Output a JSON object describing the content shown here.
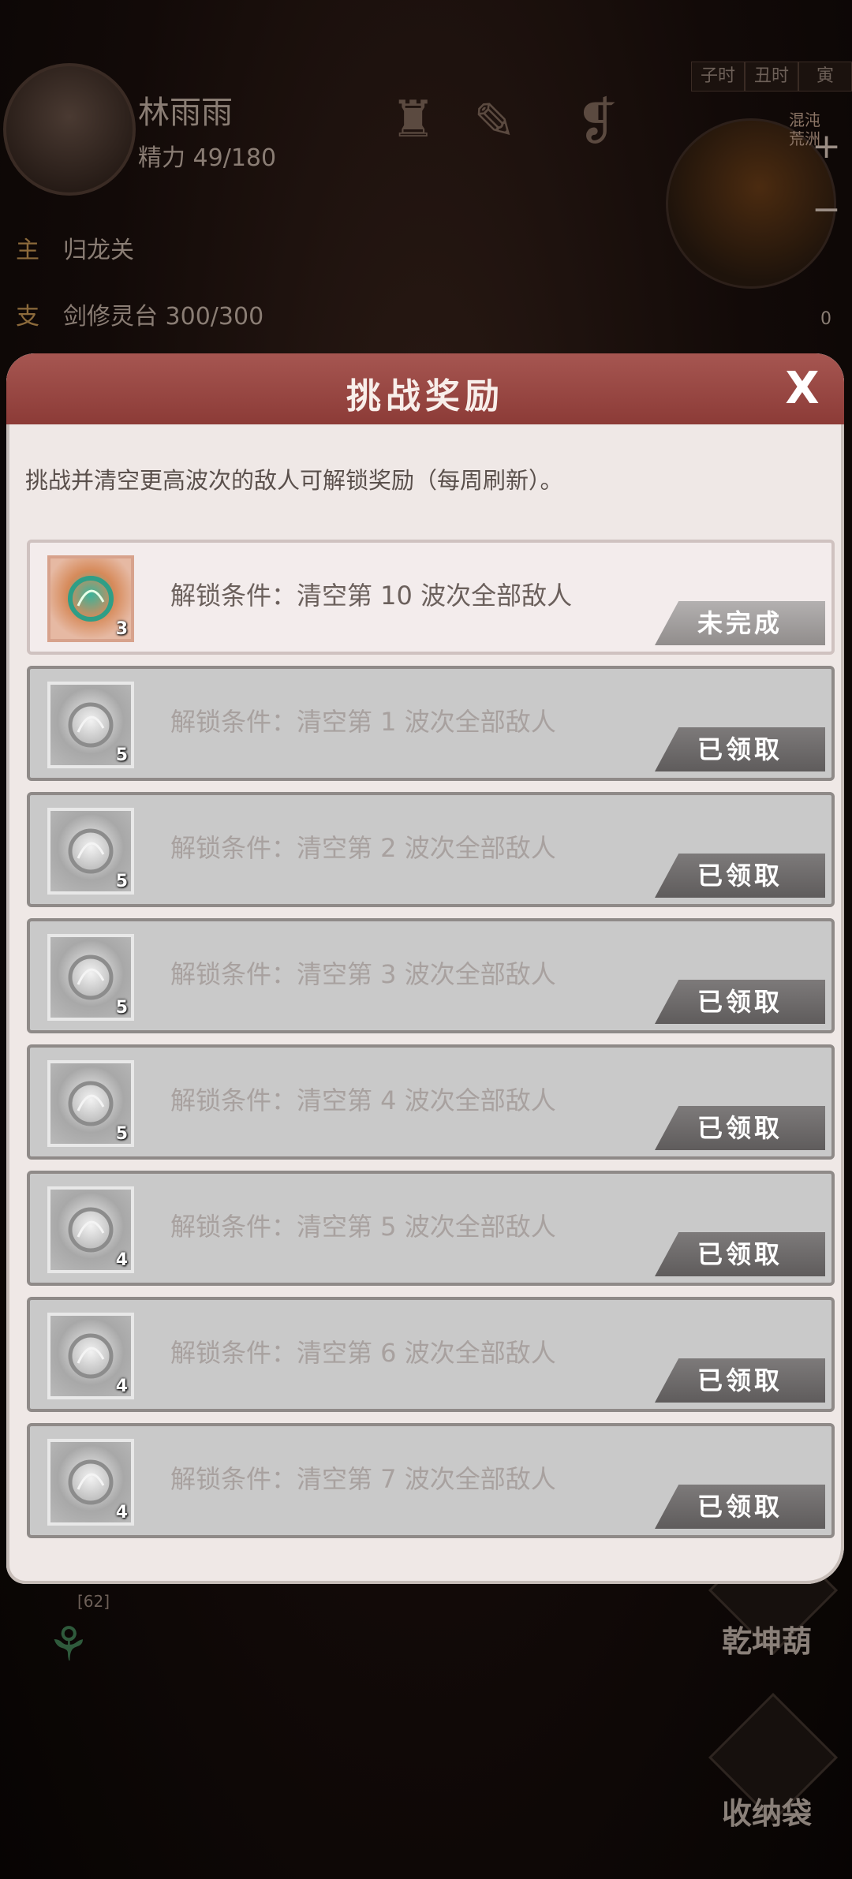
{
  "background": {
    "player": {
      "name": "林雨雨",
      "energy": "精力 49/180"
    },
    "time_tabs": [
      "子时",
      "丑时",
      "寅"
    ],
    "map_label": "混沌荒洲",
    "map_zoom_in": "+",
    "map_zoom_out": "−",
    "quests": [
      {
        "tag": "主",
        "text": "归龙关"
      },
      {
        "tag": "支",
        "text": "剑修灵台 300/300"
      }
    ],
    "badge_count": "0",
    "level_tag": "[62]",
    "side_buttons": [
      "乾坤葫",
      "收纳袋"
    ]
  },
  "dialog": {
    "title": "挑战奖励",
    "close": "X",
    "description": "挑战并清空更高波次的敌人可解锁奖励（每周刷新）。",
    "rewards": [
      {
        "count": "3",
        "condition": "解锁条件：清空第 10 波次全部敌人",
        "status": "未完成",
        "state": "active"
      },
      {
        "count": "5",
        "condition": "解锁条件：清空第 1 波次全部敌人",
        "status": "已领取",
        "state": "claimed"
      },
      {
        "count": "5",
        "condition": "解锁条件：清空第 2 波次全部敌人",
        "status": "已领取",
        "state": "claimed"
      },
      {
        "count": "5",
        "condition": "解锁条件：清空第 3 波次全部敌人",
        "status": "已领取",
        "state": "claimed"
      },
      {
        "count": "5",
        "condition": "解锁条件：清空第 4 波次全部敌人",
        "status": "已领取",
        "state": "claimed"
      },
      {
        "count": "4",
        "condition": "解锁条件：清空第 5 波次全部敌人",
        "status": "已领取",
        "state": "claimed"
      },
      {
        "count": "4",
        "condition": "解锁条件：清空第 6 波次全部敌人",
        "status": "已领取",
        "state": "claimed"
      },
      {
        "count": "4",
        "condition": "解锁条件：清空第 7 波次全部敌人",
        "status": "已领取",
        "state": "claimed"
      }
    ]
  },
  "colors": {
    "header_red": "#8c3b37",
    "dialog_bg": "#efe8e6",
    "claimed_row": "#c9c9c9"
  }
}
